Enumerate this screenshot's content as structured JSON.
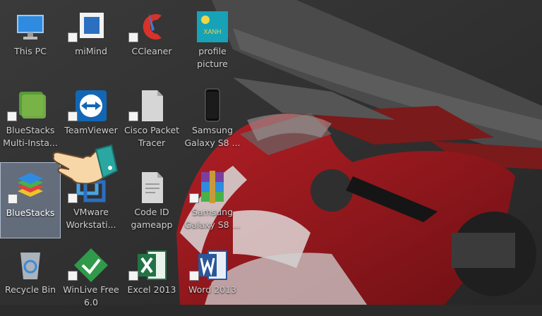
{
  "desktop": {
    "icons": [
      {
        "label": "This PC",
        "icon": "computer-icon"
      },
      {
        "label": "miMind",
        "icon": "mimind-icon"
      },
      {
        "label": "CCleaner",
        "icon": "ccleaner-icon"
      },
      {
        "label": "profile picture",
        "icon": "image-file-icon"
      },
      {
        "label": "BlueStacks Multi-Insta...",
        "icon": "bluestacks-multi-icon"
      },
      {
        "label": "TeamViewer",
        "icon": "teamviewer-icon"
      },
      {
        "label": "Cisco Packet Tracer",
        "icon": "generic-file-icon"
      },
      {
        "label": "Samsung Galaxy S8 ...",
        "icon": "phone-icon"
      },
      {
        "label": "BlueStacks",
        "icon": "bluestacks-icon",
        "selected": true
      },
      {
        "label": "VMware Workstati...",
        "icon": "vmware-icon"
      },
      {
        "label": "Code ID gameapp",
        "icon": "generic-file-icon"
      },
      {
        "label": "Samsung Galaxy S8 ...",
        "icon": "winrar-icon"
      },
      {
        "label": "Recycle Bin",
        "icon": "recycle-bin-icon"
      },
      {
        "label": "WinLive Free 6.0",
        "icon": "winlive-icon"
      },
      {
        "label": "Excel 2013",
        "icon": "excel-icon"
      },
      {
        "label": "Word 2013",
        "icon": "word-icon"
      }
    ],
    "profile_picture_caption": "XANH",
    "pointer": "pointing-hand-cursor"
  },
  "colors": {
    "wallpaper_dark": "#2b2b2b",
    "track_curb_red": "#8b1b1b",
    "bike_red": "#a31a1f",
    "selection": "#a0b4d2"
  }
}
